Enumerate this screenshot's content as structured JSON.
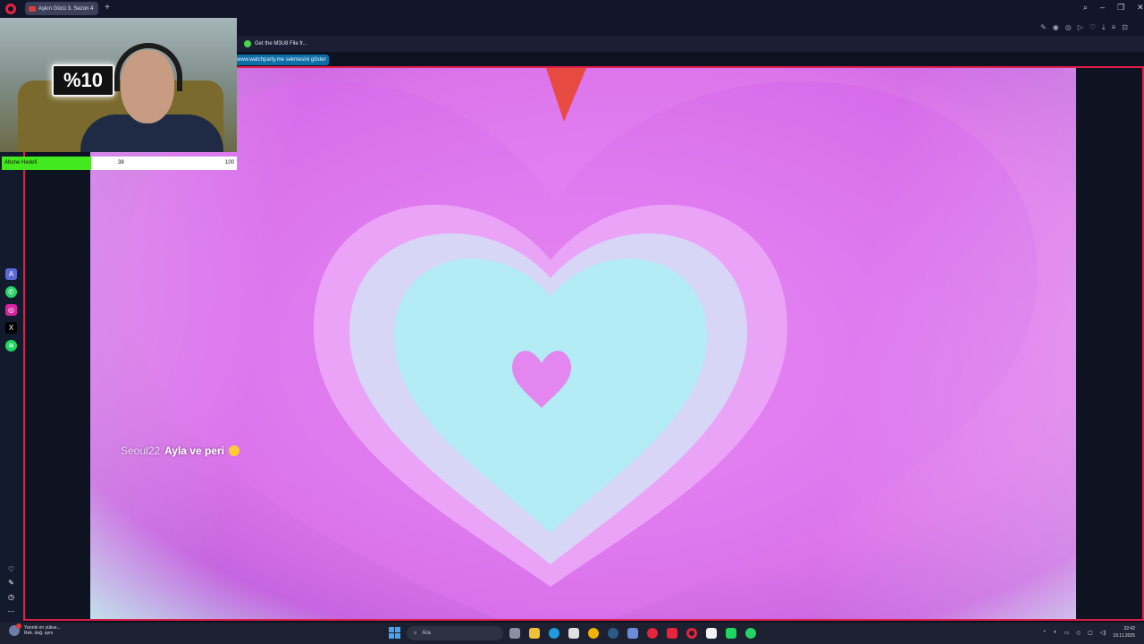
{
  "browser": {
    "tab_title": "Aşkın Gücü 3. Sezon 4",
    "new_tab": "+",
    "bookmark": "Get the M3U8 File fr...",
    "notice": "www.watchparty.me sekmesini göster"
  },
  "webcam": {
    "sign_text": "%10"
  },
  "goal": {
    "label": "Abone Hedefi",
    "current": "38",
    "max": "100",
    "progress_fraction": 0.38
  },
  "video": {
    "subtitle_user": "Seoul22",
    "subtitle_message": "Ayla ve peri"
  },
  "taskbar": {
    "weather_title": "Yarınki en yükse...",
    "weather_sub": "Rek. değ. aynı",
    "search_placeholder": "Ara",
    "time": "22:42",
    "date": "19.11.2025"
  },
  "colors": {
    "frame_accent": "#e01e4a",
    "goal_fill": "#44e81e",
    "notice_bg": "#0d6ea8"
  },
  "icons": {
    "sidebar": [
      "aria-icon",
      "whatsapp-icon",
      "instagram-icon",
      "x-icon",
      "spotify-icon",
      "heart-icon",
      "edit-icon",
      "history-icon",
      "more-icon"
    ],
    "taskbar": [
      "start-icon",
      "search-icon",
      "task-view-icon",
      "file-explorer-icon",
      "edge-icon",
      "store-icon",
      "chrome-icon",
      "steam-icon",
      "app-icon",
      "youtube-music-icon",
      "youtube-icon",
      "opera-icon",
      "capcut-icon",
      "spotify-icon",
      "whatsapp-icon"
    ]
  }
}
